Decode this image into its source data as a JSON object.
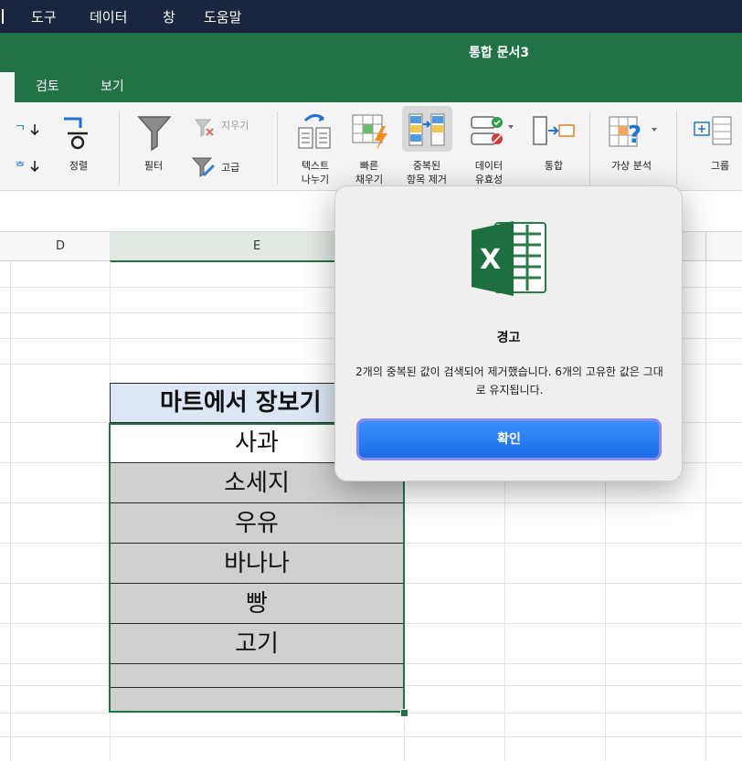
{
  "menubar": {
    "items": [
      "도구",
      "데이터",
      "창",
      "도움말"
    ]
  },
  "window": {
    "title": "통합 문서3"
  },
  "ribbon": {
    "tabs": [
      "검토",
      "보기"
    ],
    "sort_label": "정렬",
    "filter_label": "필터",
    "clear_label": "지우기",
    "advanced_label": "고급",
    "text_to_columns": [
      "텍스트",
      "나누기"
    ],
    "flash_fill": [
      "빠른",
      "채우기"
    ],
    "remove_duplicates": [
      "중복된",
      "항목 제거"
    ],
    "data_validation": [
      "데이터",
      "유효성"
    ],
    "consolidate_label": "통합",
    "what_if_label": "가상 분석",
    "group_label": "그룹"
  },
  "columns": [
    "D",
    "E"
  ],
  "sheet": {
    "header": "마트에서 장보기",
    "items": [
      "사과",
      "소세지",
      "우유",
      "바나나",
      "빵",
      "고기"
    ]
  },
  "dialog": {
    "title": "경고",
    "message": "2개의 중복된 값이 검색되어 제거했습니다. 6개의 고유한 값은 그대로 유지됩니다.",
    "ok_label": "확인",
    "icon_letter": "X"
  },
  "colors": {
    "excel_green": "#217346",
    "menubar": "#1c2540",
    "button_blue": "#1a6de8"
  }
}
